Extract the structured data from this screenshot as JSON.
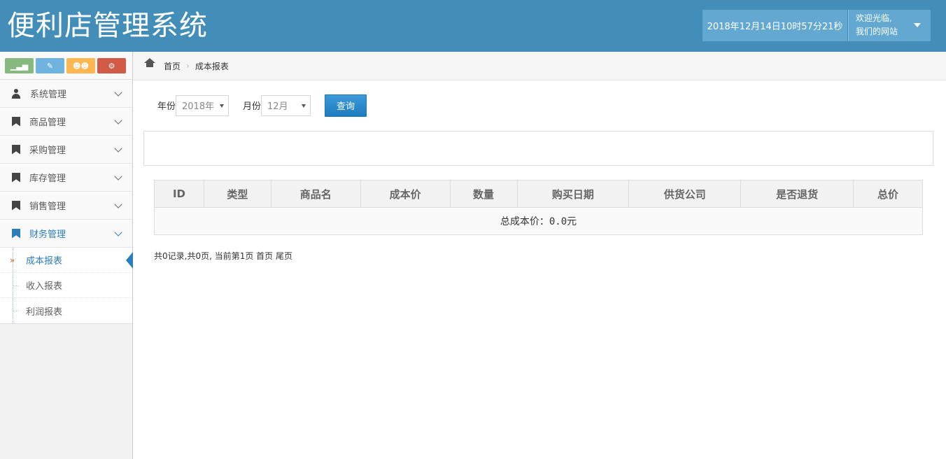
{
  "header": {
    "title": "便利店管理系统",
    "datetime": "2018年12月14日10时57分21秒",
    "welcome_line1": "欢迎光临,",
    "welcome_line2": "我们的网站"
  },
  "sidebar": {
    "shortcuts": [
      {
        "icon": "signal-icon",
        "color": "#87b87f",
        "glyph": "▁▃▅"
      },
      {
        "icon": "pencil-icon",
        "color": "#6fb3e0",
        "glyph": "✎"
      },
      {
        "icon": "users-icon",
        "color": "#ffb752",
        "glyph": "☻☻"
      },
      {
        "icon": "cogs-icon",
        "color": "#d15b47",
        "glyph": "⚙"
      }
    ],
    "items": [
      {
        "label": "系统管理",
        "icon": "user-icon"
      },
      {
        "label": "商品管理",
        "icon": "bookmark-icon"
      },
      {
        "label": "采购管理",
        "icon": "bookmark-icon"
      },
      {
        "label": "库存管理",
        "icon": "bookmark-icon"
      },
      {
        "label": "销售管理",
        "icon": "bookmark-icon"
      },
      {
        "label": "财务管理",
        "icon": "bookmark-icon",
        "active": true
      }
    ],
    "subitems": [
      {
        "label": "成本报表",
        "active": true
      },
      {
        "label": "收入报表"
      },
      {
        "label": "利润报表"
      }
    ],
    "active_color": "#2b7dbc"
  },
  "breadcrumb": {
    "home": "首页",
    "current": "成本报表"
  },
  "filter": {
    "year_label": "年份",
    "year_value": "2018年",
    "month_label": "月份",
    "month_value": "12月",
    "query_label": "查询"
  },
  "table": {
    "headers": [
      "ID",
      "类型",
      "商品名",
      "成本价",
      "数量",
      "购买日期",
      "供货公司",
      "是否退货",
      "总价"
    ],
    "summary": "总成本价：0.0元"
  },
  "pager": {
    "text": "共0记录,共0页, 当前第1页 首页 尾页"
  },
  "colors": {
    "header_bg": "#438eb9",
    "accent": "#2283c5"
  }
}
